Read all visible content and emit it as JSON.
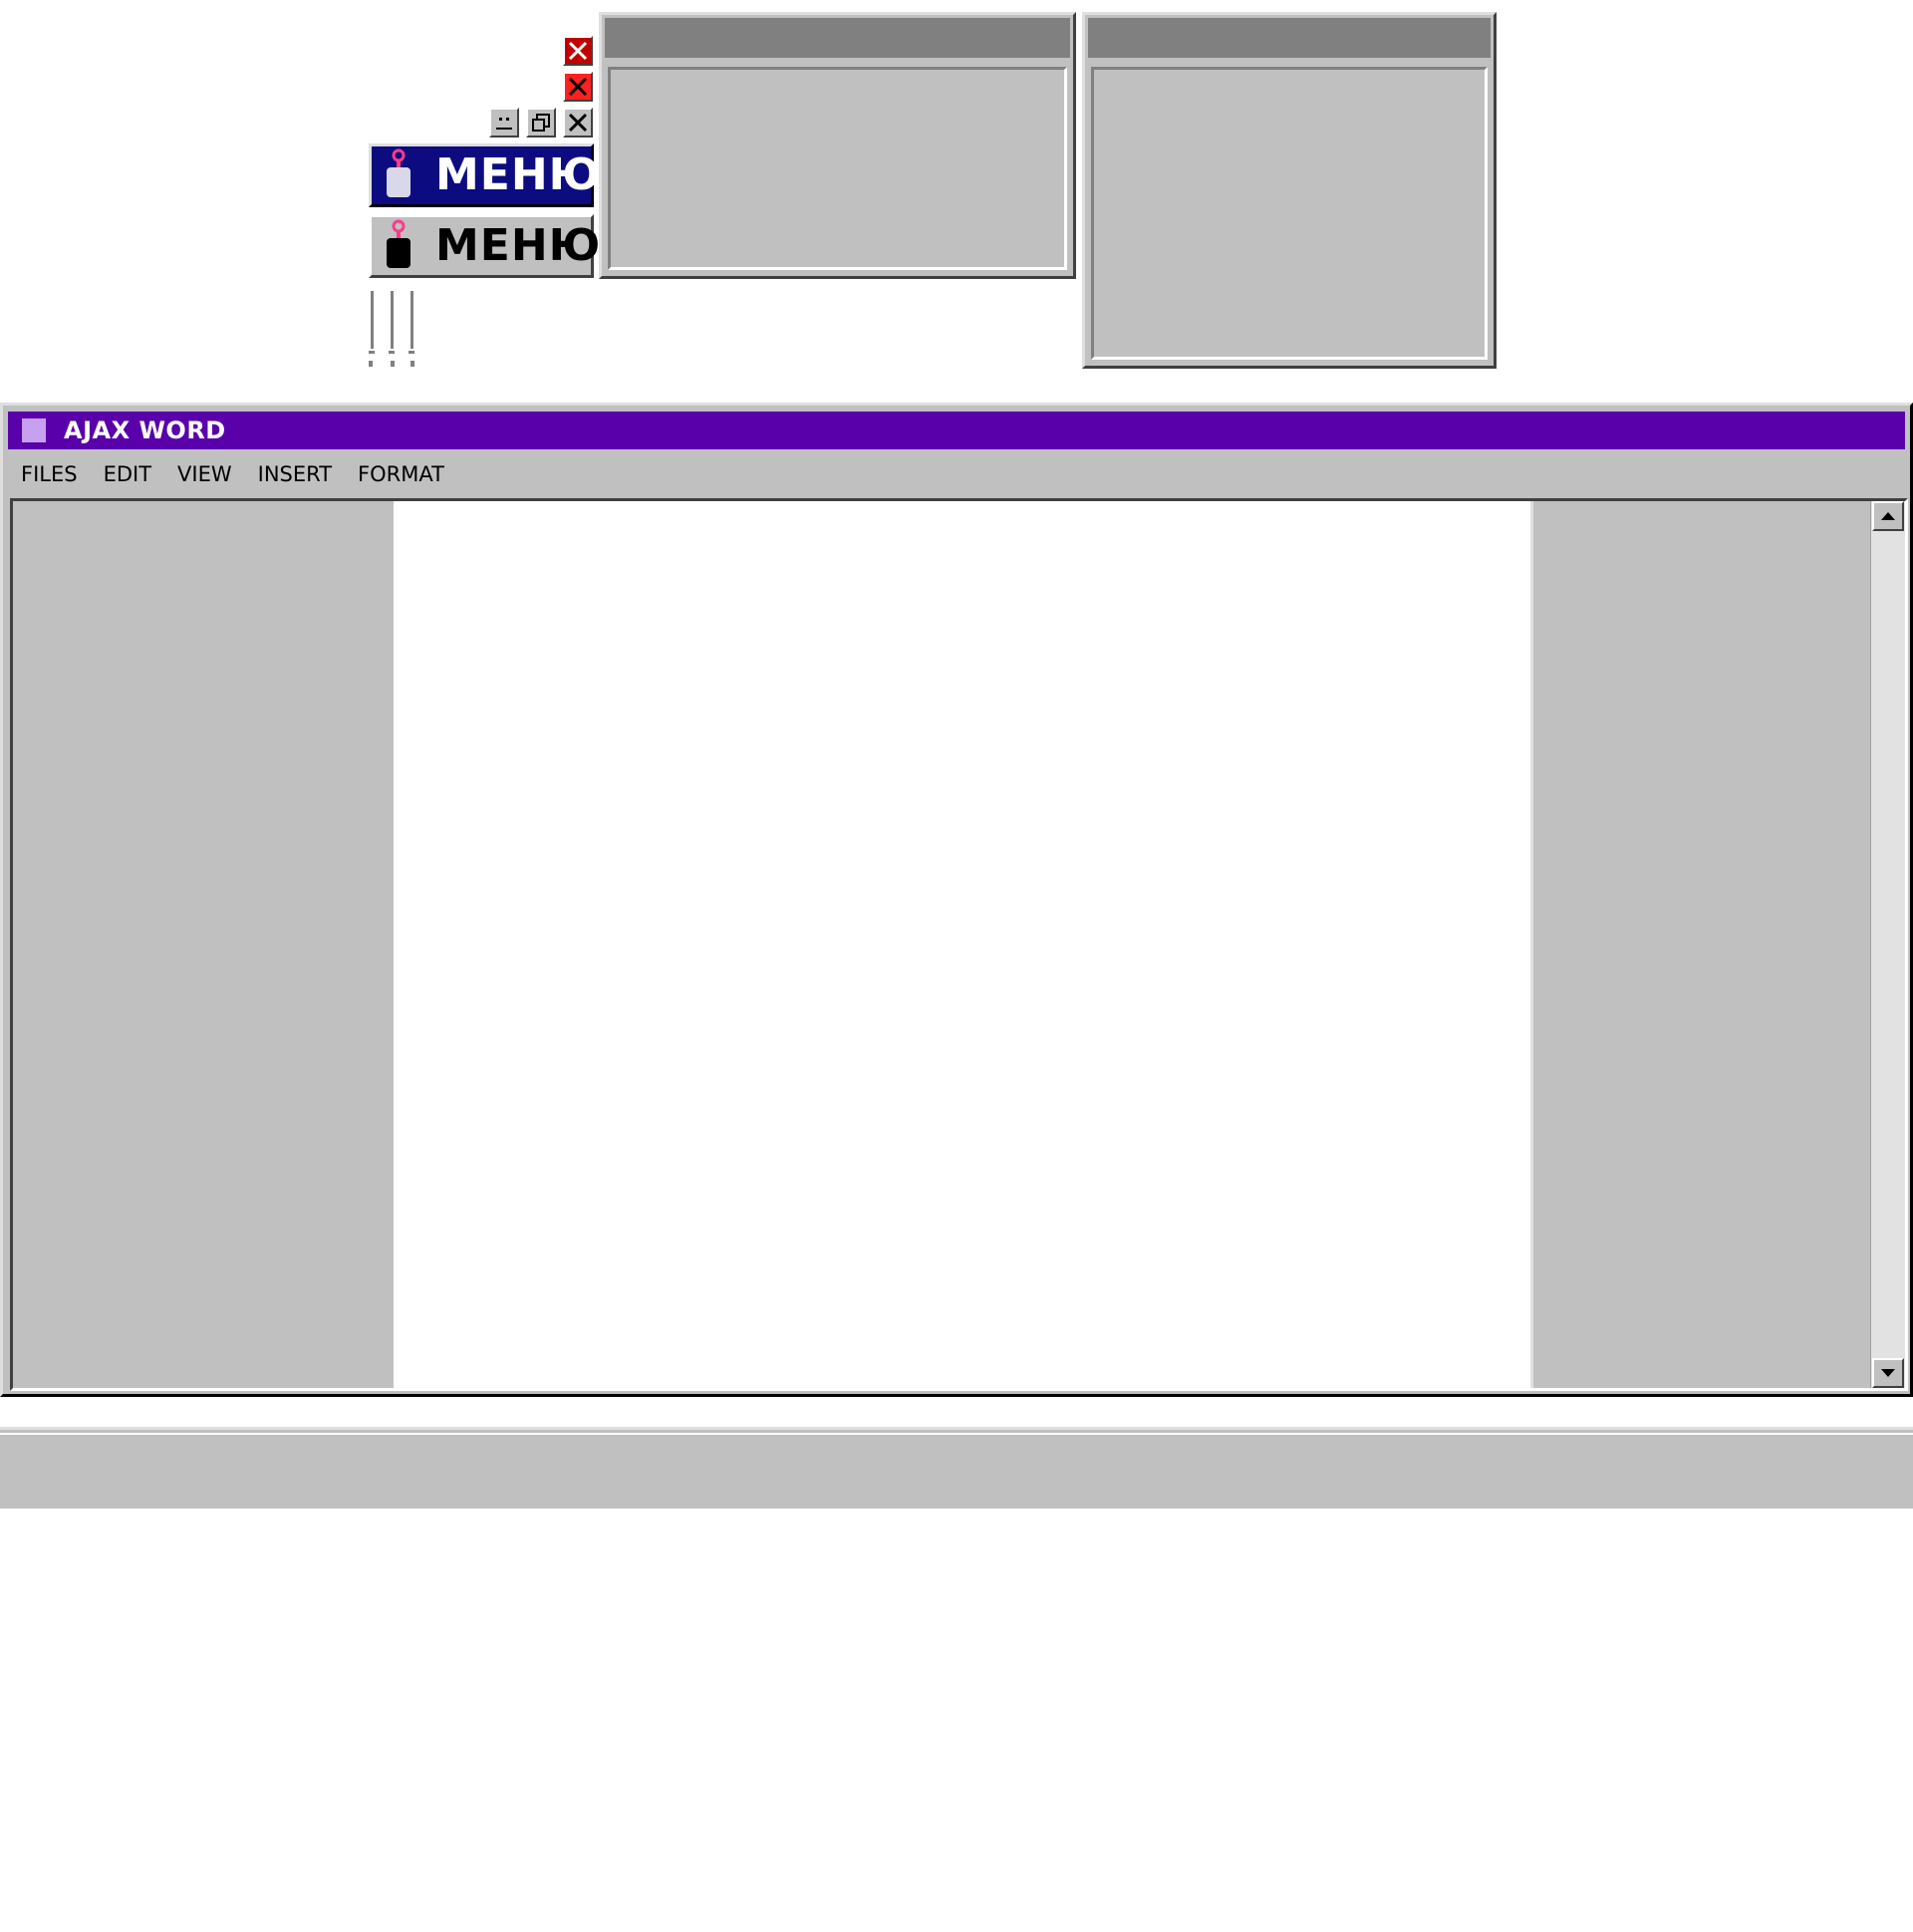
{
  "sprites": {
    "menu_buttons": [
      {
        "label": "МЕНЮ",
        "state": "active"
      },
      {
        "label": "МЕНЮ",
        "state": "normal"
      }
    ],
    "icons": [
      "close-icon-dark",
      "close-icon-bright",
      "minimize-icon",
      "restore-icon",
      "close-icon"
    ]
  },
  "window": {
    "title": "AJAX WORD",
    "title_bar_color": "#5900aa",
    "menu": [
      "FILES",
      "EDIT",
      "VIEW",
      "INSERT",
      "FORMAT"
    ]
  },
  "colors": {
    "face": "#c0c0c0",
    "active_menu": "#0c0c80",
    "title_icon": "#c8a0f0"
  }
}
